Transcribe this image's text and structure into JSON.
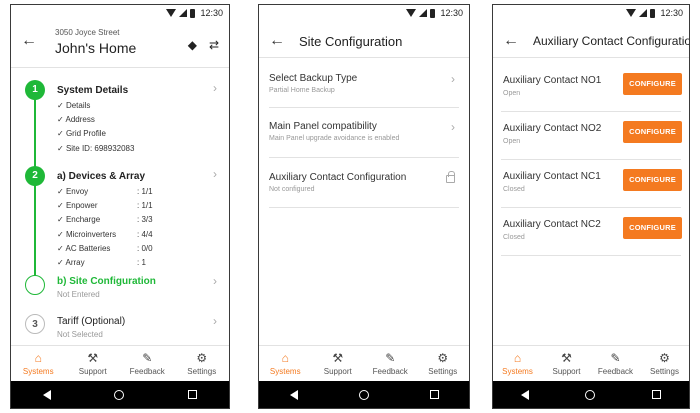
{
  "status": {
    "time": "12:30"
  },
  "nav": [
    {
      "label": "Systems",
      "icon": "home-icon"
    },
    {
      "label": "Support",
      "icon": "wrench-icon"
    },
    {
      "label": "Feedback",
      "icon": "feedback-icon"
    },
    {
      "label": "Settings",
      "icon": "gear-icon"
    }
  ],
  "screen1": {
    "address": "3050 Joyce Street",
    "home_name": "John's Home",
    "steps": [
      {
        "number": "1",
        "title": "System Details",
        "checks": [
          {
            "label": "Details"
          },
          {
            "label": "Address"
          },
          {
            "label": "Grid Profile"
          },
          {
            "label": "Site ID: 698932083"
          }
        ]
      },
      {
        "number": "2",
        "title": "a) Devices & Array",
        "checks": [
          {
            "label": "Envoy",
            "value": ": 1/1"
          },
          {
            "label": "Enpower",
            "value": ": 1/1"
          },
          {
            "label": "Encharge",
            "value": ": 3/3"
          },
          {
            "label": "Microinverters",
            "value": ": 4/4"
          },
          {
            "label": "AC Batteries",
            "value": ": 0/0"
          },
          {
            "label": "Array",
            "value": ": 1"
          }
        ]
      },
      {
        "title": "b) Site Configuration",
        "subtitle": "Not Entered"
      },
      {
        "number": "3",
        "title": "Tariff (Optional)",
        "subtitle": "Not Selected"
      }
    ]
  },
  "screen2": {
    "title": "Site Configuration",
    "items": [
      {
        "title": "Select Backup Type",
        "subtitle": "Partial Home Backup"
      },
      {
        "title": "Main Panel compatibility",
        "subtitle": "Main Panel upgrade avoidance is enabled"
      },
      {
        "title": "Auxiliary Contact Configuration",
        "subtitle": "Not configured"
      }
    ]
  },
  "screen3": {
    "title": "Auxiliary Contact Configuration",
    "button_label": "CONFIGURE",
    "items": [
      {
        "title": "Auxiliary Contact NO1",
        "subtitle": "Open"
      },
      {
        "title": "Auxiliary Contact NO2",
        "subtitle": "Open"
      },
      {
        "title": "Auxiliary Contact NC1",
        "subtitle": "Closed"
      },
      {
        "title": "Auxiliary Contact NC2",
        "subtitle": "Closed"
      }
    ]
  },
  "colors": {
    "accent": "#f47a20",
    "green": "#1fb838"
  }
}
